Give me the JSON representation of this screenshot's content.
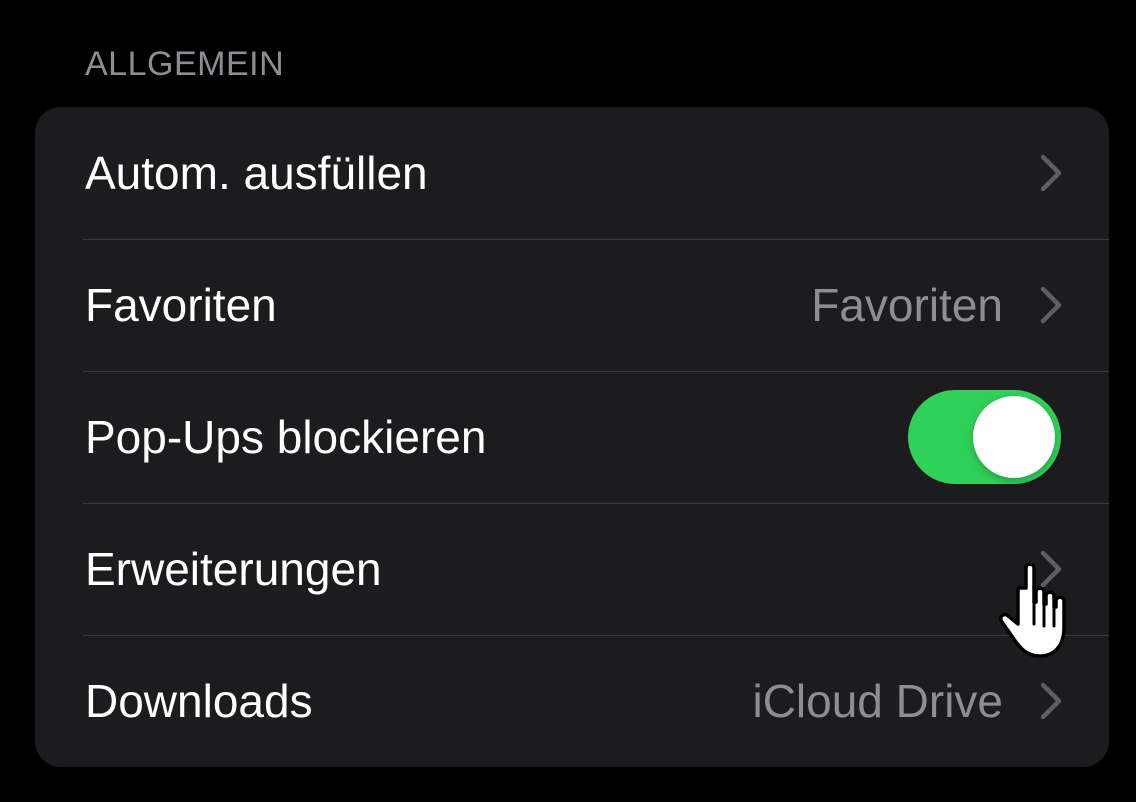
{
  "section": {
    "title": "ALLGEMEIN"
  },
  "rows": [
    {
      "label": "Autom. ausfüllen",
      "value": "",
      "control": "chevron"
    },
    {
      "label": "Favoriten",
      "value": "Favoriten",
      "control": "chevron"
    },
    {
      "label": "Pop-Ups blockieren",
      "value": "",
      "control": "toggle",
      "toggle_on": true
    },
    {
      "label": "Erweiterungen",
      "value": "",
      "control": "chevron"
    },
    {
      "label": "Downloads",
      "value": "iCloud Drive",
      "control": "chevron"
    }
  ],
  "colors": {
    "background": "#000000",
    "group_background": "#1c1c1e",
    "separator": "#3a3a3c",
    "secondary_text": "#8d8d93",
    "toggle_on": "#30d158"
  },
  "icons": {
    "chevron": "chevron-right-icon",
    "cursor": "hand-pointer-icon"
  }
}
